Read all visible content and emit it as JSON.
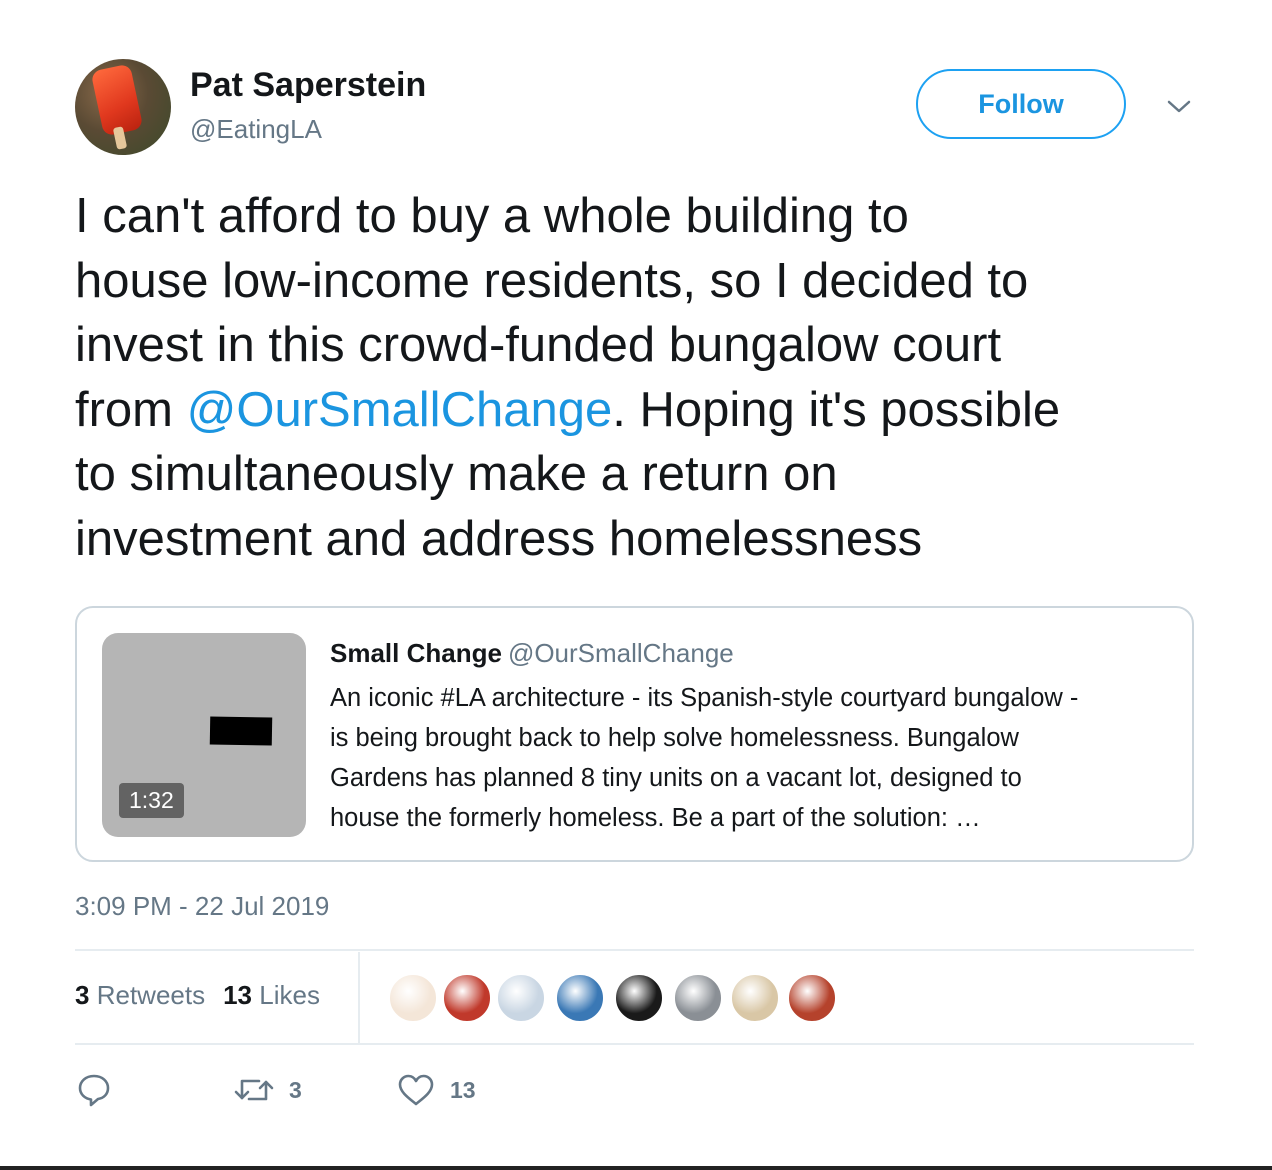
{
  "author": {
    "name": "Pat Saperstein",
    "handle": "@EatingLA"
  },
  "follow_label": "Follow",
  "tweet": {
    "lines": [
      "I can't afford to buy a whole building to",
      "house low-income residents, so I decided to",
      "invest in this crowd-funded bungalow court"
    ],
    "line4_prefix": "from ",
    "mention": "@OurSmallChange",
    "line4_suffix": ". Hoping it's possible",
    "lines_end": [
      "to simultaneously make a return on",
      "investment and address homelessness"
    ]
  },
  "quote": {
    "name": "Small Change",
    "handle": "@OurSmallChange",
    "video_duration": "1:32",
    "lines": [
      "An iconic #LA architecture - its Spanish-style courtyard bungalow -",
      "is being brought back to help solve homelessness. Bungalow",
      "Gardens has planned 8 tiny units on a vacant lot, designed to",
      "house the formerly homeless. Be a part of the solution: …"
    ]
  },
  "timestamp": "3:09 PM - 22 Jul 2019",
  "stats": {
    "retweets_count": "3",
    "retweets_label": "Retweets",
    "likes_count": "13",
    "likes_label": "Likes"
  },
  "likers_avatar_colors": [
    "#f4e6d8",
    "#c0392b",
    "#c9d6e3",
    "#3a78b5",
    "#1a1a1a",
    "#8a8f95",
    "#d9c7a6",
    "#b5422c"
  ],
  "actions": {
    "reply_icon": "reply-icon",
    "retweet_count": "3",
    "like_count": "13"
  },
  "colors": {
    "accent": "#1da1f2",
    "link": "#1b95e0",
    "secondary_text": "#657786",
    "border": "#ccd6dd"
  }
}
